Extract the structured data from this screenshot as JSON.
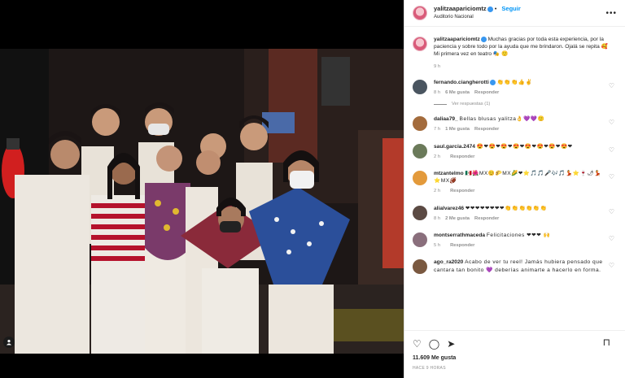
{
  "post": {
    "username": "yalitzaapariciomtz",
    "follow_label": "Seguir",
    "location": "Auditorio Nacional",
    "more_icon": "more-horizontal-icon",
    "caption": {
      "username": "yalitzaapariciomtz",
      "text": "Muchas gracias por toda esta experiencia, por la paciencia y sobre todo por la ayuda que me brindaron. Ojalá se repita 🥰",
      "text2": "Mi primera vez en teatro 🎭 🙂",
      "time": "9 h"
    }
  },
  "comments": [
    {
      "username": "fernando.ciangherotti",
      "verified": true,
      "text": "👏👏👏👍✌",
      "time": "8 h",
      "likes": "6 Me gusta",
      "reply": "Responder",
      "view_replies": "Ver respuestas (1)",
      "avatar_color": "#4a5560"
    },
    {
      "username": "daliaa79_",
      "verified": false,
      "text": "Bellas blusas yalitza👌💜💜🙂",
      "time": "7 h",
      "likes": "1 Me gusta",
      "reply": "Responder",
      "avatar_color": "#a36b3c"
    },
    {
      "username": "saul.garcia.2474",
      "verified": false,
      "text": "😍❤😍❤😍❤😍❤😍❤😍❤😍❤😍❤",
      "time": "2 h",
      "likes": "",
      "reply": "Responder",
      "avatar_color": "#6b7a5a"
    },
    {
      "username": "mtzantelmo",
      "verified": false,
      "text": "🇲🇽🌺MX😊🌮MX🌽❤⭐🎵🎵🎤🎶🎵💃⭐🍷🌶💃⭐MX🏈",
      "time": "2 h",
      "likes": "",
      "reply": "Responder",
      "avatar_color": "#e39a3b"
    },
    {
      "username": "alialvarez46",
      "verified": false,
      "text": "❤❤❤❤❤❤❤❤👏👏👏👏👏👏",
      "time": "8 h",
      "likes": "2 Me gusta",
      "reply": "Responder",
      "avatar_color": "#5b4a43"
    },
    {
      "username": "montserrathmaceda",
      "verified": false,
      "text": "Felicitaciones ❤❤❤ 🙌",
      "time": "5 h",
      "likes": "",
      "reply": "Responder",
      "avatar_color": "#8a6f7c"
    },
    {
      "username": "ago_ra2020",
      "verified": false,
      "text": "Acabo de ver tu reel! Jamás hubiera pensado que cantara tan bonito 💜 deberías animarte a hacerlo en forma.",
      "time": "",
      "likes": "",
      "reply": "",
      "avatar_color": "#7a5940"
    }
  ],
  "actions": {
    "like_icon": "heart-icon",
    "comment_icon": "comment-icon",
    "share_icon": "share-icon",
    "save_icon": "bookmark-icon",
    "likes": "11.609 Me gusta",
    "posted": "HACE 9 HORAS"
  }
}
